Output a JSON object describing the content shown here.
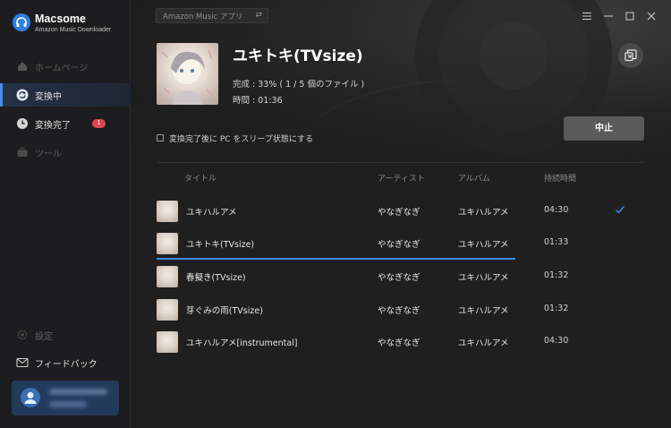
{
  "app": {
    "name": "Macsome",
    "subtitle": "Amazon Music Downloader",
    "accent": "#3b8df0"
  },
  "sidebar": {
    "items": [
      {
        "label": "ホームページ",
        "icon": "home-icon",
        "state": "disabled"
      },
      {
        "label": "変換中",
        "icon": "converting-icon",
        "state": "active"
      },
      {
        "label": "変換完了",
        "icon": "clock-icon",
        "state": "normal",
        "badge": "1"
      },
      {
        "label": "ツール",
        "icon": "toolbox-icon",
        "state": "disabled"
      }
    ],
    "bottom": [
      {
        "label": "設定",
        "icon": "gear-icon",
        "state": "disabled"
      },
      {
        "label": "フィードバック",
        "icon": "mail-icon",
        "state": "normal"
      }
    ]
  },
  "topbar": {
    "source_label": "Amazon Music アプリ",
    "swap_glyph": "⇄",
    "window_controls": [
      "menu-icon",
      "minimize-icon",
      "maximize-icon",
      "close-icon"
    ]
  },
  "current": {
    "title": "ユキトキ(TVsize)",
    "progress_text": "完成 : 33% ( 1 / 5 個のファイル )",
    "time_text": "時間 : 01:36",
    "stop_label": "中止",
    "sleep_label": "変換完了後に PC をスリープ状態にする",
    "sleep_checked": false
  },
  "table": {
    "headers": [
      "タイトル",
      "アーティスト",
      "アルバム",
      "持続時間"
    ],
    "rows": [
      {
        "title": "ユキハルアメ",
        "artist": "やなぎなぎ",
        "album": "ユキハルアメ",
        "duration": "04:30",
        "status": "done"
      },
      {
        "title": "ユキトキ(TVsize)",
        "artist": "やなぎなぎ",
        "album": "ユキハルアメ",
        "duration": "01:33",
        "status": "converting",
        "progress": 1.0
      },
      {
        "title": "春擬き(TVsize)",
        "artist": "やなぎなぎ",
        "album": "ユキハルアメ",
        "duration": "01:32",
        "status": "waiting"
      },
      {
        "title": "芽ぐみの雨(TVsize)",
        "artist": "やなぎなぎ",
        "album": "ユキハルアメ",
        "duration": "01:32",
        "status": "waiting"
      },
      {
        "title": "ユキハルアメ[instrumental]",
        "artist": "やなぎなぎ",
        "album": "ユキハルアメ",
        "duration": "04:30",
        "status": "waiting"
      }
    ]
  }
}
